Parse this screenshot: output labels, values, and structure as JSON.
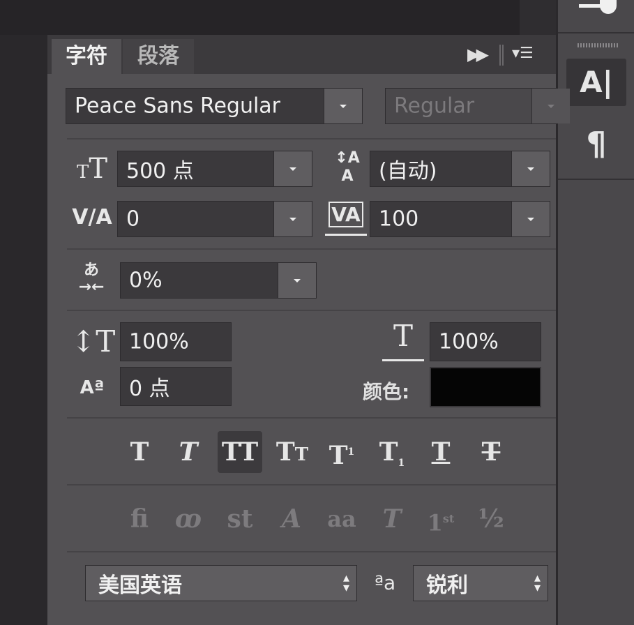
{
  "tabs": [
    {
      "label": "字符",
      "active": true
    },
    {
      "label": "段落",
      "active": false
    }
  ],
  "font": {
    "family": "Peace Sans Regular",
    "style": "Regular"
  },
  "size": {
    "value": "500 点",
    "icon": "font-size-icon"
  },
  "leading": {
    "value": "(自动)",
    "icon": "leading-icon"
  },
  "kerning": {
    "value": "0",
    "icon": "kerning-icon"
  },
  "tracking": {
    "value": "100",
    "icon": "tracking-icon"
  },
  "tsume": {
    "value": "0%",
    "icon": "tsume-icon"
  },
  "vertical_scale": {
    "value": "100%",
    "icon": "vertical-scale-icon"
  },
  "horizontal_scale": {
    "value": "100%",
    "icon": "horizontal-scale-icon"
  },
  "baseline_shift": {
    "value": "0 点",
    "icon": "baseline-shift-icon"
  },
  "color": {
    "label": "颜色:",
    "value": "#050505"
  },
  "style_buttons": [
    {
      "glyph": "T",
      "name": "faux-bold"
    },
    {
      "glyph": "T",
      "name": "faux-italic"
    },
    {
      "glyph": "TT",
      "name": "all-caps",
      "selected": true
    },
    {
      "glyph": "Tт",
      "name": "small-caps"
    },
    {
      "glyph": "T¹",
      "name": "superscript"
    },
    {
      "glyph": "T₁",
      "name": "subscript"
    },
    {
      "glyph": "T",
      "name": "underline"
    },
    {
      "glyph": "T",
      "name": "strikethrough"
    }
  ],
  "opentype_buttons": [
    {
      "glyph": "fi",
      "name": "standard-ligatures"
    },
    {
      "glyph": "ꝏ",
      "name": "contextual-alternates"
    },
    {
      "glyph": "st",
      "name": "discretionary-ligatures"
    },
    {
      "glyph": "A",
      "name": "swash"
    },
    {
      "glyph": "aa",
      "name": "stylistic-alternates"
    },
    {
      "glyph": "T",
      "name": "titling-alternates"
    },
    {
      "glyph": "1st",
      "name": "ordinals"
    },
    {
      "glyph": "½",
      "name": "fractions"
    }
  ],
  "language": "美国英语",
  "antialias_icon_label": "ªa",
  "antialias": "锐利",
  "colors": {
    "panel": "#535154",
    "field": "#3b393c",
    "accent": "#e8e8e8"
  }
}
